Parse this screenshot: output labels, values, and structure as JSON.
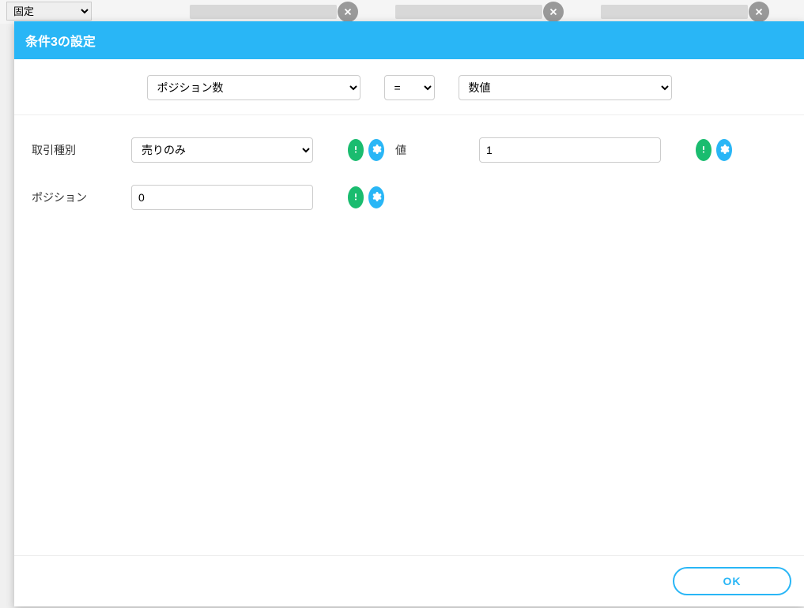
{
  "background": {
    "select_value": "固定"
  },
  "modal": {
    "title": "条件3の設定",
    "top_row": {
      "left_select": "ポジション数",
      "operator_select": "=",
      "right_select": "数値"
    },
    "fields": {
      "trade_type": {
        "label": "取引種別",
        "value": "売りのみ"
      },
      "value": {
        "label": "値",
        "value": "1"
      },
      "position": {
        "label": "ポジション",
        "value": "0"
      }
    },
    "footer": {
      "ok_label": "OK"
    }
  },
  "icons": {
    "alert": "alert-icon",
    "gear": "gear-icon",
    "close": "close-icon"
  },
  "colors": {
    "header_bg": "#29b6f6",
    "green_btn": "#1abc6f",
    "blue_btn": "#29b6f6"
  }
}
